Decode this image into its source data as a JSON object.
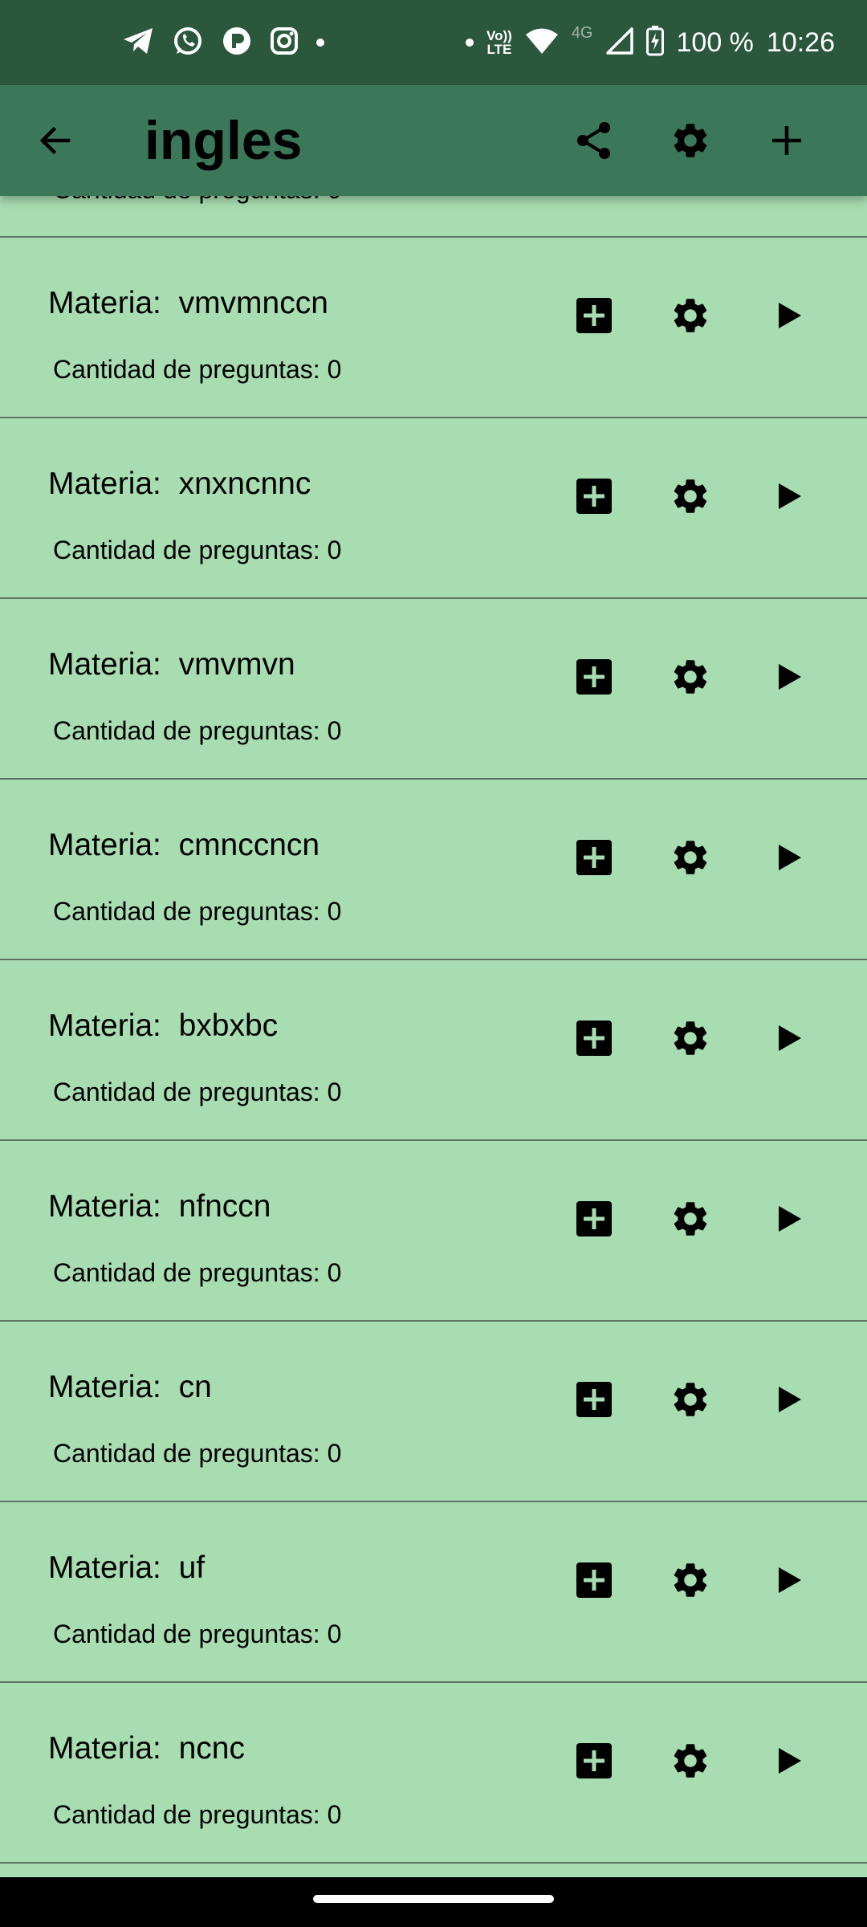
{
  "status_bar": {
    "battery_percent": "100 %",
    "time": "10:26",
    "volte_top": "Vo))",
    "volte_bottom": "LTE",
    "network": "4G",
    "left_icons": [
      "telegram-icon",
      "whatsapp-icon",
      "app-icon",
      "instagram-icon"
    ]
  },
  "app_bar": {
    "title": "ingles",
    "actions": [
      "share-icon",
      "settings-icon",
      "add-icon"
    ]
  },
  "list": {
    "partial_item_count": "Cantidad de preguntas: 0",
    "label_prefix": "Materia:  ",
    "items": [
      {
        "name": "vmvmnccn",
        "count": "Cantidad de preguntas: 0"
      },
      {
        "name": "xnxncnnc",
        "count": "Cantidad de preguntas: 0"
      },
      {
        "name": "vmvmvn",
        "count": "Cantidad de preguntas: 0"
      },
      {
        "name": "cmnccncn",
        "count": "Cantidad de preguntas: 0"
      },
      {
        "name": "bxbxbc",
        "count": "Cantidad de preguntas: 0"
      },
      {
        "name": "nfnccn",
        "count": "Cantidad de preguntas: 0"
      },
      {
        "name": "cn",
        "count": "Cantidad de preguntas: 0"
      },
      {
        "name": "uf",
        "count": "Cantidad de preguntas: 0"
      },
      {
        "name": "ncnc",
        "count": "Cantidad de preguntas: 0"
      }
    ]
  },
  "colors": {
    "status_bar": "#2b573c",
    "app_bar": "#3b785a",
    "list_background": "#a8ddb1",
    "divider": "#5f7365"
  }
}
